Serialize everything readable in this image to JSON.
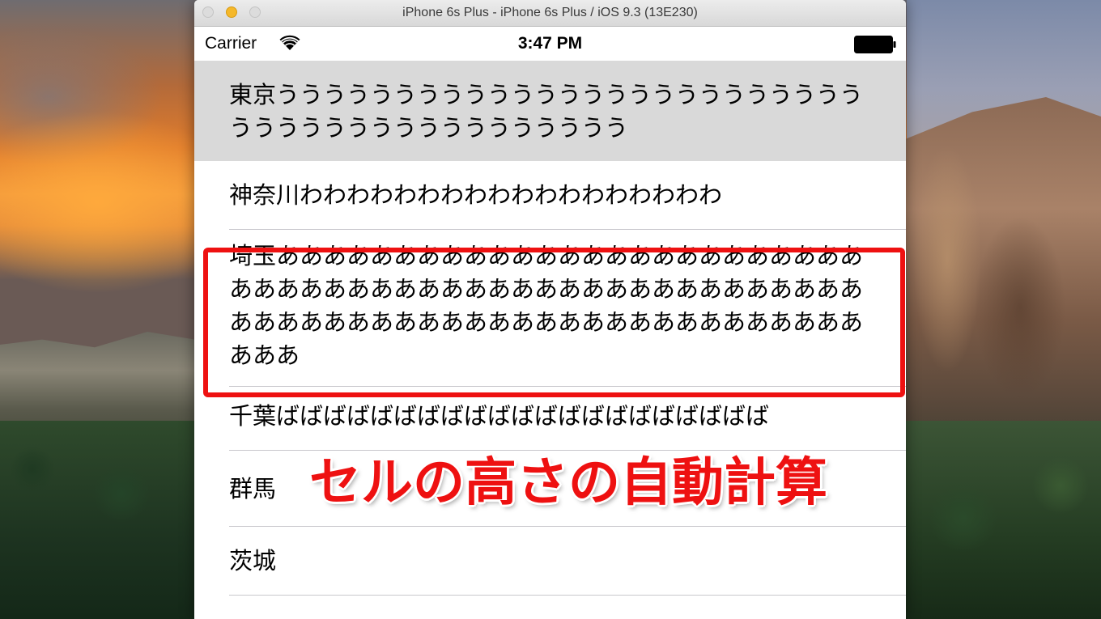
{
  "window": {
    "title": "iPhone 6s Plus - iPhone 6s Plus / iOS 9.3 (13E230)"
  },
  "status_bar": {
    "carrier": "Carrier",
    "time": "3:47 PM",
    "wifi_icon": "wifi-icon",
    "battery_icon": "battery-icon"
  },
  "table": {
    "selected_row": 0,
    "rows": [
      {
        "label": "東京うううううううううううううううううううううううううううううううううううううううううう"
      },
      {
        "label": "神奈川わわわわわわわわわわわわわわわわわわ"
      },
      {
        "label": "埼玉ああああああああああああああああああああああああああああああああああああああああああああああああああああああああああああああああああああああああああああああああああ"
      },
      {
        "label": "千葉ばばばばばばばばばばばばばばばばばばばばば"
      },
      {
        "label": "群馬"
      },
      {
        "label": "茨城"
      }
    ]
  },
  "annotation": {
    "caption": "セルの高さの自動計算",
    "color": "#ee1111"
  }
}
